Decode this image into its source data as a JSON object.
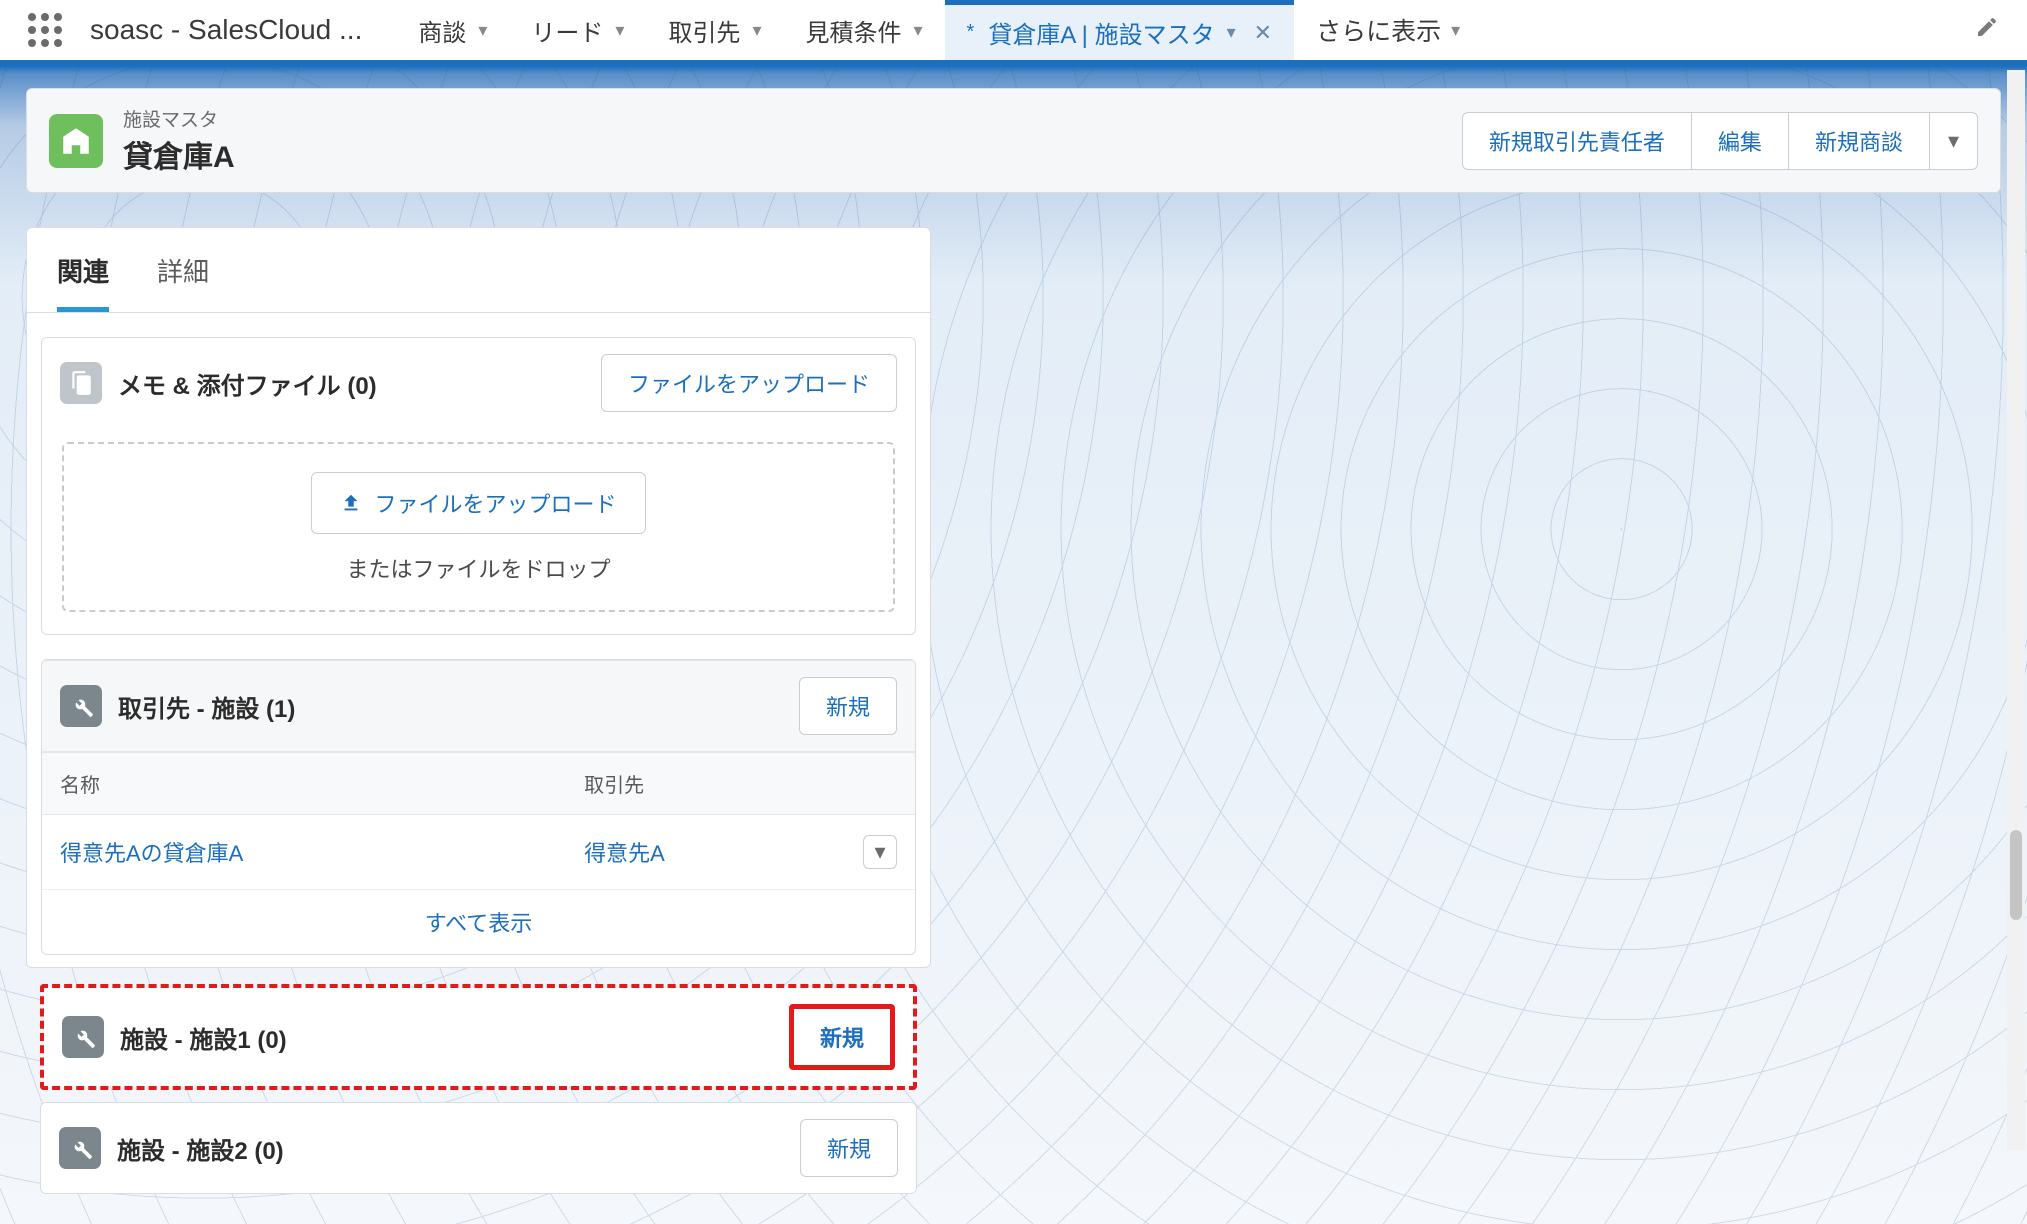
{
  "nav": {
    "app_name": "soasc - SalesCloud ...",
    "tabs": [
      {
        "label": "商談"
      },
      {
        "label": "リード"
      },
      {
        "label": "取引先"
      },
      {
        "label": "見積条件"
      }
    ],
    "active_tab": "貸倉庫A | 施設マスタ",
    "more": "さらに表示"
  },
  "header": {
    "object_kind": "施設マスタ",
    "record_title": "貸倉庫A",
    "actions": {
      "new_contact": "新規取引先責任者",
      "edit": "編集",
      "new_opp": "新規商談"
    }
  },
  "tabs": {
    "related": "関連",
    "details": "詳細"
  },
  "attachments": {
    "title": "メモ & 添付ファイル (0)",
    "upload_btn": "ファイルをアップロード",
    "inner_upload": "ファイルをアップロード",
    "drop_text": "またはファイルをドロップ"
  },
  "accounts_facility": {
    "title": "取引先 - 施設 (1)",
    "new_btn": "新規",
    "cols": {
      "name": "名称",
      "account": "取引先"
    },
    "rows": [
      {
        "name": "得意先Aの貸倉庫A",
        "account": "得意先A"
      }
    ],
    "view_all": "すべて表示"
  },
  "facility1": {
    "title": "施設 - 施設1 (0)",
    "new_btn": "新規"
  },
  "facility2": {
    "title": "施設 - 施設2 (0)",
    "new_btn": "新規"
  }
}
